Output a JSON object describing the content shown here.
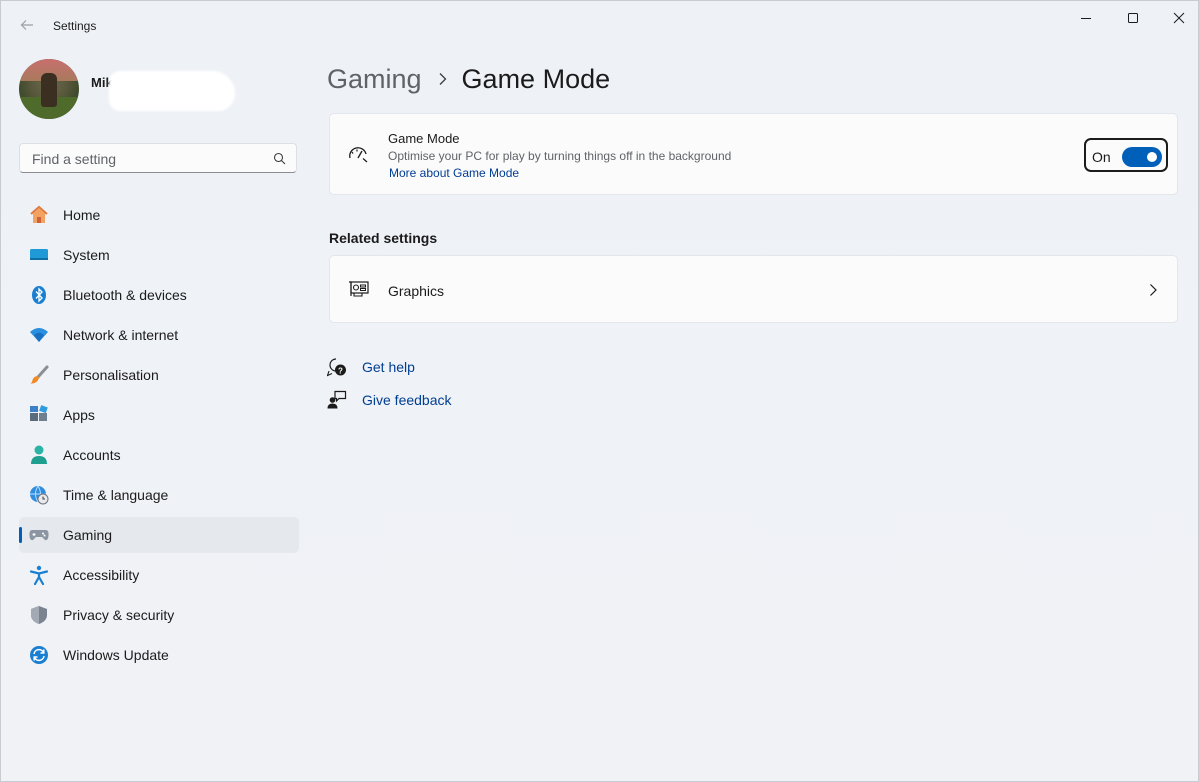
{
  "window": {
    "title": "Settings",
    "controls": {
      "minimize": "minimize-icon",
      "maximize": "maximize-icon",
      "close": "close-icon"
    }
  },
  "user": {
    "name": "Mika"
  },
  "search": {
    "placeholder": "Find a setting",
    "value": ""
  },
  "sidebar": {
    "items": [
      {
        "label": "Home",
        "icon": "home-icon"
      },
      {
        "label": "System",
        "icon": "system-icon"
      },
      {
        "label": "Bluetooth & devices",
        "icon": "bluetooth-icon"
      },
      {
        "label": "Network & internet",
        "icon": "wifi-icon"
      },
      {
        "label": "Personalisation",
        "icon": "brush-icon"
      },
      {
        "label": "Apps",
        "icon": "apps-icon"
      },
      {
        "label": "Accounts",
        "icon": "accounts-icon"
      },
      {
        "label": "Time & language",
        "icon": "globe-clock-icon"
      },
      {
        "label": "Gaming",
        "icon": "gamepad-icon",
        "active": true
      },
      {
        "label": "Accessibility",
        "icon": "accessibility-icon"
      },
      {
        "label": "Privacy & security",
        "icon": "shield-icon"
      },
      {
        "label": "Windows Update",
        "icon": "update-icon"
      }
    ]
  },
  "main": {
    "breadcrumb": {
      "parent": "Gaming",
      "current": "Game Mode"
    },
    "game_mode": {
      "title": "Game Mode",
      "description": "Optimise your PC for play by turning things off in the background",
      "link": "More about Game Mode",
      "toggle_label": "On",
      "toggle_on": true
    },
    "related_title": "Related settings",
    "related": [
      {
        "label": "Graphics",
        "icon": "graphics-card-icon"
      }
    ],
    "help_links": {
      "help": "Get help",
      "feedback": "Give feedback"
    }
  },
  "colors": {
    "accent": "#005fb8",
    "link": "#003e92",
    "background": "#eff3f8",
    "card": "#fbfbfc"
  }
}
